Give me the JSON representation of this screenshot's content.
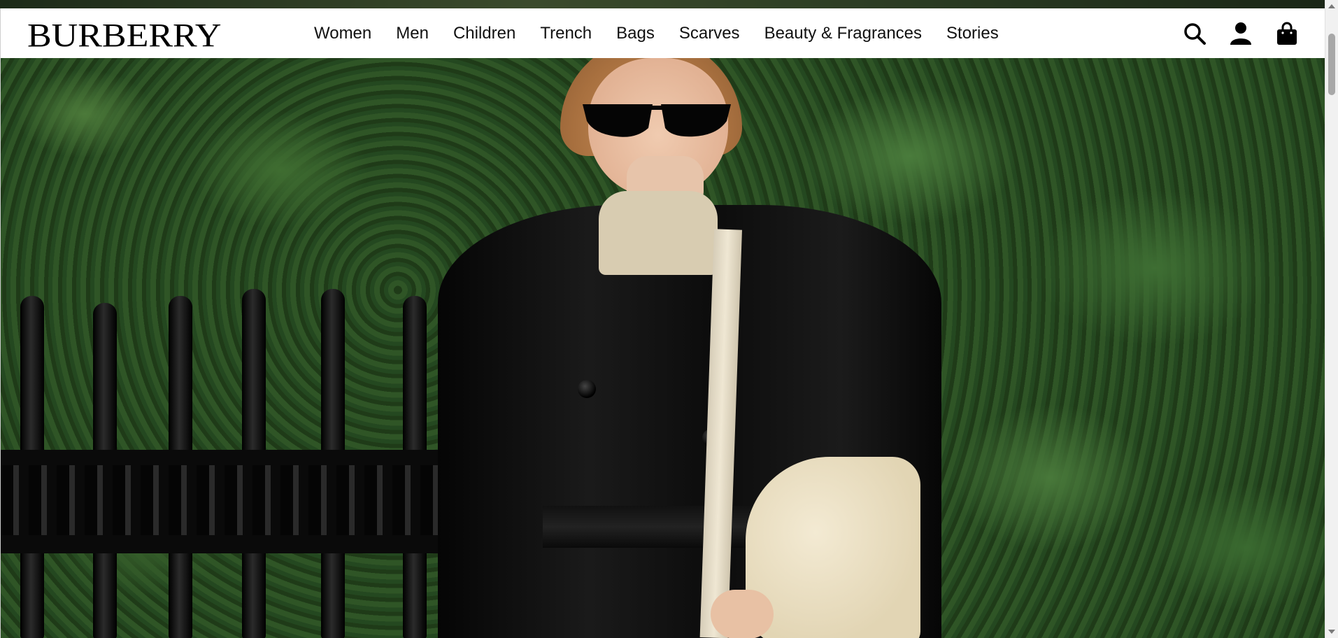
{
  "header": {
    "logo": "BURBERRY",
    "nav": [
      {
        "label": "Women"
      },
      {
        "label": "Men"
      },
      {
        "label": "Children"
      },
      {
        "label": "Trench"
      },
      {
        "label": "Bags"
      },
      {
        "label": "Scarves"
      },
      {
        "label": "Beauty & Fragrances"
      },
      {
        "label": "Stories"
      }
    ],
    "icons": [
      "search-icon",
      "account-icon",
      "shopping-bag-icon"
    ]
  },
  "hero": {
    "image": "model-in-black-trench-coat"
  },
  "colors": {
    "header_bg": "#ffffff",
    "text": "#111111",
    "foliage": "#2f5526"
  }
}
